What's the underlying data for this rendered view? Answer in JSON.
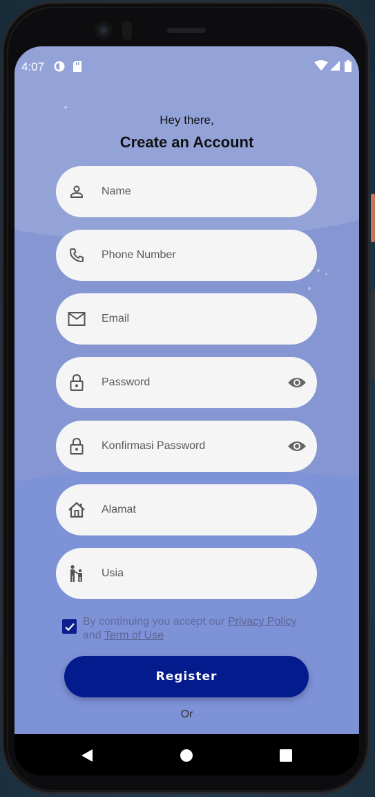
{
  "status_bar": {
    "time": "4:07",
    "left_icons": [
      "data-saver-icon",
      "sd-card-icon"
    ],
    "right_icons": [
      "wifi-icon",
      "cellular-icon",
      "battery-icon"
    ]
  },
  "header": {
    "greeting": "Hey there,",
    "title": "Create an Account"
  },
  "form": {
    "fields": [
      {
        "icon": "person-icon",
        "placeholder": "Name",
        "value": ""
      },
      {
        "icon": "phone-icon",
        "placeholder": "Phone Number",
        "value": ""
      },
      {
        "icon": "mail-icon",
        "placeholder": "Email",
        "value": ""
      },
      {
        "icon": "lock-icon",
        "placeholder": "Password",
        "value": "",
        "trailing_icon": "eye-icon"
      },
      {
        "icon": "lock-icon",
        "placeholder": "Konfirmasi Password",
        "value": "",
        "trailing_icon": "eye-icon"
      },
      {
        "icon": "home-icon",
        "placeholder": "Alamat",
        "value": ""
      },
      {
        "icon": "family-icon",
        "placeholder": "Usia",
        "value": ""
      }
    ],
    "terms": {
      "checked": true,
      "prefix": "By continuing you accept our ",
      "privacy_link": "Privacy Policy",
      "middle": "and ",
      "terms_link": "Term of Use"
    },
    "register_label": "Register",
    "or_label": "Or"
  },
  "colors": {
    "background": "#8696d2",
    "field_bg": "#f5f5f6",
    "button": "#041b8e",
    "checkbox": "#0b1f8f"
  },
  "nav": [
    "back-icon",
    "home-circle-icon",
    "recents-icon"
  ]
}
